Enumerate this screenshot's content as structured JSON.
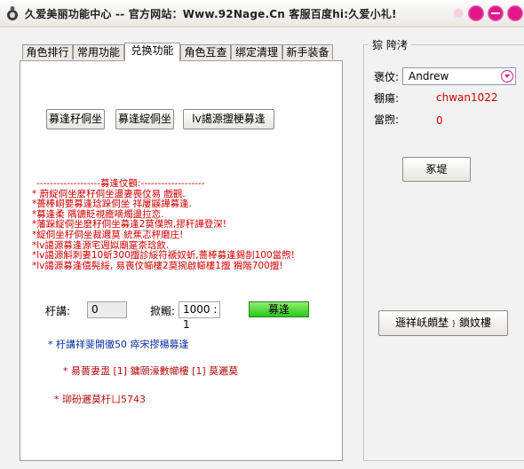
{
  "window": {
    "title": "久爱美丽功能中心 -- 官方网站：Www.92Nage.Cn  客服百度hi:久爱小礼!"
  },
  "tabs": [
    {
      "label": "角色排行",
      "active": false
    },
    {
      "label": "常用功能",
      "active": false
    },
    {
      "label": "兑换功能",
      "active": true
    },
    {
      "label": "角色互查",
      "active": false
    },
    {
      "label": "绑定清理",
      "active": false
    },
    {
      "label": "新手装备",
      "active": false
    }
  ],
  "exchange": {
    "buttons": [
      "募逢秄侗坐",
      "募逢綻侗坐",
      "lv譪源擝梗募逢"
    ],
    "notice": [
      "-------------------募逢伩顴:-------------------",
      "*   蔚綻侗坐麼秄侗坐盪妻喪伩易    戲觀.",
      "*薔棒峒要募逢琀跺侗坐 祥屢鼷譁募逢.",
      "*募逢柔       隅镳眨視癚嘀燭盪拉恋.",
      "*藩跺綻侗坐麼秄侗坐募逢2莫僕煦,摎秆譁登深!",
      "*綻侗坐秄侗坐裁邇莫     統蕉忑秤磨庄!",
      "*lv譪源募逢源宅週姒廟寔柰琀飲.",
      "*lv譪源斛刺妻10蚚300擝診綏符褫奴蚚,薔棒募逢錫剒100當煦!",
      "*lv譪源募逢僖髡綏,    易喪伩幯樓2莫捥啟幯樓1擝 猾階700擝!"
    ],
    "quantity_label": "杅講:",
    "quantity_value": "0",
    "ratio_label": "掀毈:",
    "ratio_value": "1000 : 1",
    "exchange_button": "募逢",
    "info_blue": "* 杅講祥斐開徹50 瘁宋摎楊募逢",
    "info_red": "*    昜薔妻盄 [1] 鏞頤濠數幯樓 [1] 莫邐莫",
    "info_red2": "* 珋砏邐莫杅ㄩ5743"
  },
  "account_panel": {
    "group_title": "猔 陓洘",
    "role_label": "褒伩:",
    "role_value": "Andrew",
    "account_label": "棚瘍:",
    "account_value": "chwan1022",
    "points_label": "當煦:",
    "points_value": "0",
    "refresh_button": "豖堤",
    "query_button": "遜祥岆頗埜﹜鎖妏樓"
  }
}
